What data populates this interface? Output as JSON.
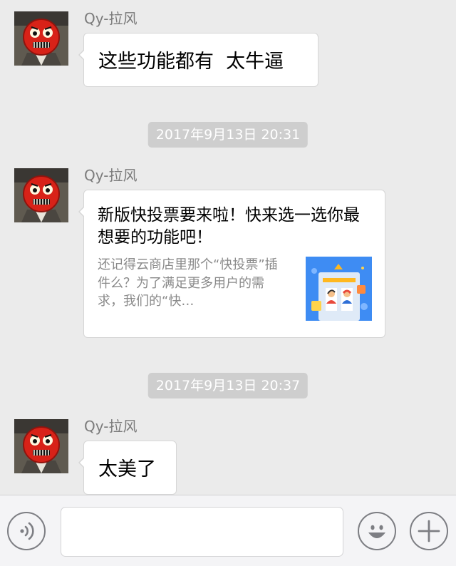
{
  "chat": {
    "messages": [
      {
        "sender": "Qy-拉风",
        "text": "这些功能都有  太牛逼"
      },
      {
        "timestamp": "2017年9月13日 20:31"
      },
      {
        "sender": "Qy-拉风",
        "card": {
          "title": "新版快投票要来啦！快来选一选你最想要的功能吧！",
          "description": "还记得云商店里那个“快投票”插件么？为了满足更多用户的需求，我们的“快…",
          "thumbnail_icon": "vote-card-thumbnail"
        }
      },
      {
        "timestamp": "2017年9月13日 20:37"
      },
      {
        "sender": "Qy-拉风",
        "text": "太美了"
      }
    ]
  },
  "input_bar": {
    "voice_icon": "voice-icon",
    "text_value": "",
    "emoji_icon": "emoji-icon",
    "plus_icon": "plus-icon"
  },
  "colors": {
    "background": "#ebebeb",
    "bubble": "#ffffff",
    "timestamp_bg": "#cecece",
    "sender_text": "#7b7b7b",
    "input_bar_bg": "#f4f4f6"
  }
}
